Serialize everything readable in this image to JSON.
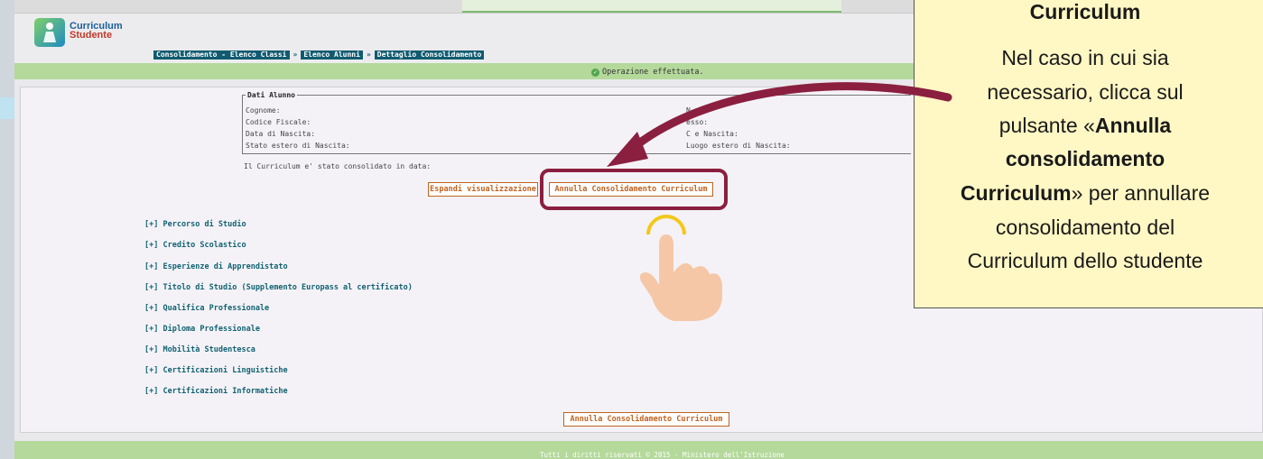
{
  "app": {
    "logo_line1": "Curriculum",
    "logo_line2": "Studente"
  },
  "breadcrumb": [
    {
      "label": "Consolidamento - Elenco Classi"
    },
    {
      "label": "Elenco Alunni"
    },
    {
      "label": "Dettaglio Consolidamento"
    }
  ],
  "breadcrumb_sep": "»",
  "status": {
    "message": "Operazione effettuata.",
    "icon": "check-circle-icon"
  },
  "student": {
    "legend": "Dati Alunno",
    "left_fields": [
      "Cognome:",
      "Codice Fiscale:",
      "Data di Nascita:",
      "Stato estero di Nascita:"
    ],
    "right_fields": [
      "N",
      "esso:",
      "C    e Nascita:",
      "Luogo estero di Nascita:"
    ]
  },
  "consolidated_text": "Il Curriculum e' stato consolidato in data:",
  "buttons": {
    "expand": "Espandi visualizzazione",
    "annulla_top": "Annulla Consolidamento Curriculum",
    "annulla_bottom": "Annulla Consolidamento Curriculum"
  },
  "sections": [
    "[+]  Percorso di Studio",
    "[+]  Credito Scolastico",
    "[+]  Esperienze di Apprendistato",
    "[+]  Titolo di Studio (Supplemento Europass al certificato)",
    "[+]  Qualifica Professionale",
    "[+]  Diploma Professionale",
    "[+]  Mobilità Studentesca",
    "[+]  Certificazioni Linguistiche",
    "[+]  Certificazioni Informatiche"
  ],
  "footer": "Tutti i diritti riservati © 2015 -  Ministero dell'Istruzione",
  "callout": {
    "title": "Curriculum",
    "line1": "Nel caso in cui sia",
    "line2": "necessario, clicca sul",
    "line3a": "pulsante «",
    "line3b": "Annulla",
    "line4": "consolidamento",
    "line5a": "Curriculum",
    "line5b": "» per annullare",
    "line6": "consolidamento del",
    "line7": "Curriculum dello studente"
  },
  "colors": {
    "accent": "#115b70",
    "button": "#c0631f",
    "highlight": "#8b1f3f",
    "green_bar": "#b4d99b"
  }
}
